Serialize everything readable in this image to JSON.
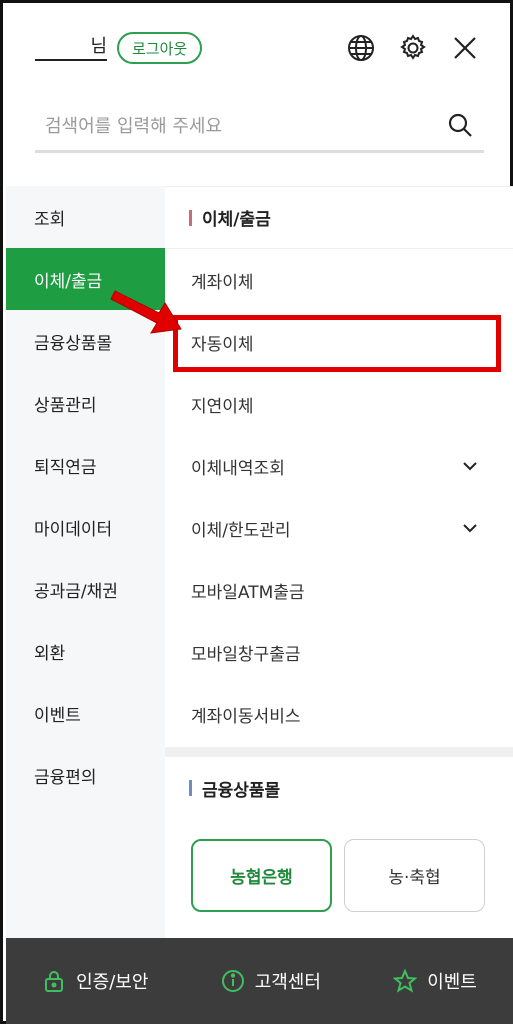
{
  "header": {
    "user_suffix": "님",
    "logout_label": "로그아웃",
    "icons": [
      "globe-icon",
      "gear-icon",
      "close-icon"
    ]
  },
  "search": {
    "placeholder": "검색어를 입력해 주세요"
  },
  "left_menu": {
    "items": [
      {
        "label": "조회"
      },
      {
        "label": "이체/출금",
        "active": true
      },
      {
        "label": "금융상품몰"
      },
      {
        "label": "상품관리"
      },
      {
        "label": "퇴직연금"
      },
      {
        "label": "마이데이터"
      },
      {
        "label": "공과금/채권"
      },
      {
        "label": "외환"
      },
      {
        "label": "이벤트"
      },
      {
        "label": "금융편의"
      }
    ]
  },
  "right_menu": {
    "section1_title": "이체/출금",
    "items": [
      {
        "label": "계좌이체"
      },
      {
        "label": "자동이체",
        "highlighted": true
      },
      {
        "label": "지연이체"
      },
      {
        "label": "이체내역조회",
        "expandable": true
      },
      {
        "label": "이체/한도관리",
        "expandable": true
      },
      {
        "label": "모바일ATM출금"
      },
      {
        "label": "모바일창구출금"
      },
      {
        "label": "계좌이동서비스"
      }
    ],
    "section2_title": "금융상품몰",
    "bank_buttons": [
      {
        "label": "농협은행"
      },
      {
        "label": "농·축협"
      }
    ]
  },
  "bottom_bar": {
    "items": [
      {
        "label": "인증/보안",
        "icon": "lock-icon"
      },
      {
        "label": "고객센터",
        "icon": "info-icon"
      },
      {
        "label": "이벤트",
        "icon": "star-icon"
      }
    ]
  },
  "colors": {
    "accent": "#1f9d43",
    "highlight": "#e00000",
    "bottom_bar": "#3c3c3c"
  }
}
